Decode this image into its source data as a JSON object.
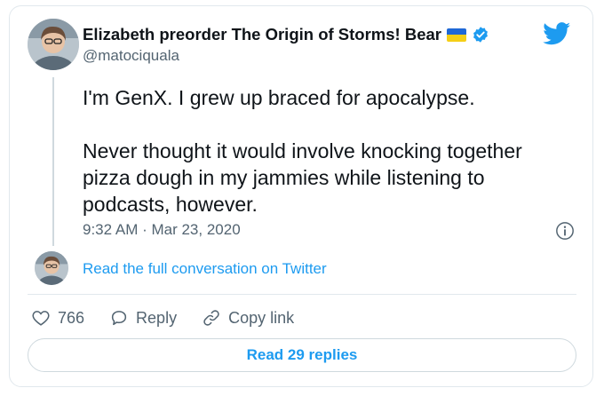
{
  "tweet": {
    "author": {
      "display_name": "Elizabeth preorder The Origin of Storms! Bear",
      "handle": "@matociquala",
      "flag_icon": "ukraine-flag-icon",
      "verified_icon": "verified-badge-icon"
    },
    "brand_icon": "twitter-bird-icon",
    "text_paragraphs": [
      "I'm GenX. I grew up braced for apocalypse.",
      "Never thought it would involve knocking together pizza dough in my jammies while listening to podcasts, however."
    ],
    "timestamp": "9:32 AM · Mar 23, 2020",
    "info_icon": "info-icon",
    "read_full_conversation": "Read the full conversation on Twitter",
    "actions": {
      "like_count": "766",
      "reply_label": "Reply",
      "copy_link_label": "Copy link"
    },
    "read_replies_label": "Read 29 replies"
  },
  "colors": {
    "link_blue": "#1d9bf0",
    "text_primary": "#0f1419",
    "text_secondary": "#536471",
    "border": "#e1e8ed"
  }
}
